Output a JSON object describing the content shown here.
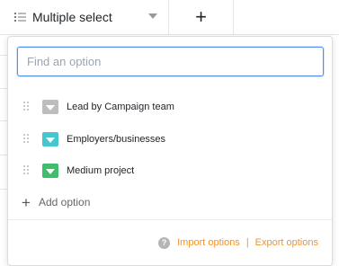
{
  "header": {
    "column_title": "Multiple select",
    "add_column_symbol": "+"
  },
  "popup": {
    "search": {
      "placeholder": "Find an option",
      "value": ""
    },
    "options": [
      {
        "label": "Lead by Campaign team",
        "color": "#bdbdbd"
      },
      {
        "label": "Employers/businesses",
        "color": "#46c6cd"
      },
      {
        "label": "Medium project",
        "color": "#3ebe6b"
      }
    ],
    "add_option_label": "Add option",
    "footer": {
      "help_symbol": "?",
      "import_label": "Import options",
      "separator": "|",
      "export_label": "Export options"
    }
  },
  "colors": {
    "accent": "#5190ef",
    "link": "#f0932b"
  }
}
